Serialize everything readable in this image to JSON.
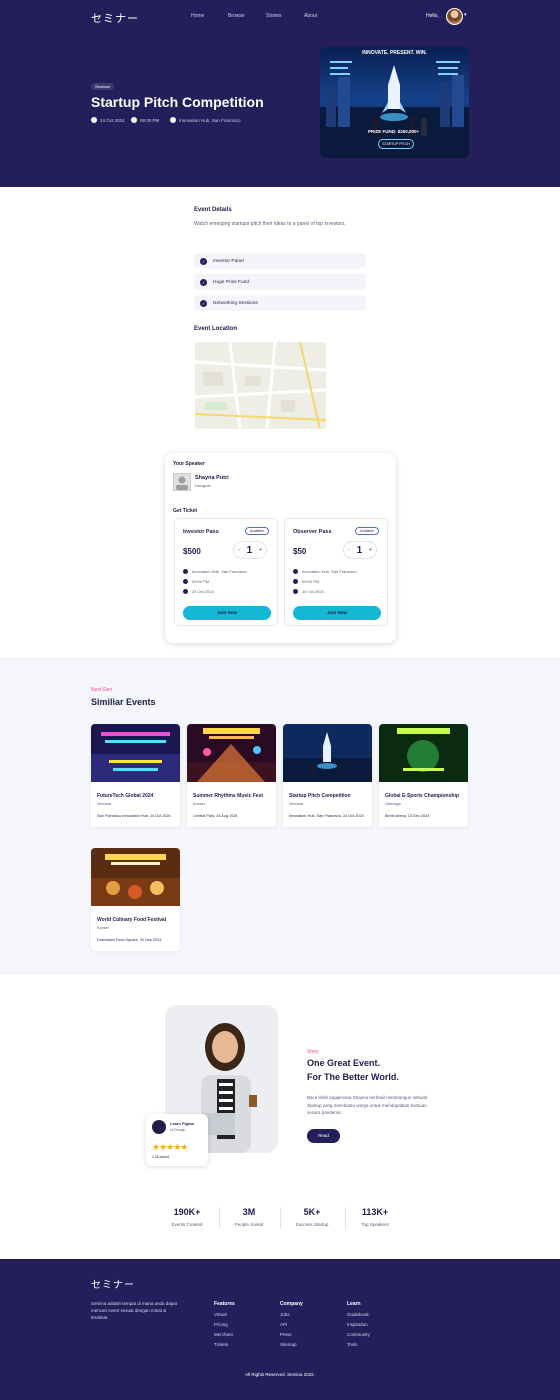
{
  "brand": {
    "logo": "セミナー"
  },
  "nav": {
    "items": [
      "Home",
      "Browse",
      "Stories",
      "About"
    ],
    "greeting": "Hello,"
  },
  "hero": {
    "tag": "Seminar",
    "title": "Startup Pitch Competition",
    "date": "24 Oct 2024",
    "time": "09:00 PM",
    "location": "Innovation Hub, San Francisco",
    "poster": {
      "headline": "INNOVATE. PRESENT. WIN.",
      "prize": "PRIZE FUND: $250,000+",
      "badge": "STARTUP PITCH"
    }
  },
  "details": {
    "heading": "Event Details",
    "description": "Watch emerging startups pitch their ideas to a panel of top investors.",
    "features": [
      "Investor Panel",
      "Huge Prize Fund",
      "Networking Sessions"
    ],
    "location_heading": "Event Location"
  },
  "speaker": {
    "heading": "Your Speaker",
    "name": "Shayna Putri",
    "role": "Designer"
  },
  "tickets": {
    "heading": "Get Ticket",
    "items": [
      {
        "name": "Investor Pass",
        "badge": "Available",
        "price": "$500",
        "qty": "1",
        "location": "Innovation Hub, San Francisco",
        "time": "09:00 PM",
        "date": "24 Oct 2024",
        "cta": "Join Now"
      },
      {
        "name": "Observer Pass",
        "badge": "Available",
        "price": "$50",
        "qty": "1",
        "location": "Innovation Hub, San Francisco",
        "time": "09:00 PM",
        "date": "24 Oct 2024",
        "cta": "Join Now"
      }
    ],
    "minus": "-",
    "plus": "+"
  },
  "similar": {
    "eyebrow": "Next Gen",
    "heading": "Similiar Events",
    "events": [
      {
        "title": "FutureTech Global 2024",
        "category": "Seminar",
        "location": "San Francisco Innovation Hub, 14 Oct 2024"
      },
      {
        "title": "Summer Rhythms Music Fest",
        "category": "Konser",
        "location": "Central Park, 24 Aug 2024"
      },
      {
        "title": "Startup Pitch Competition",
        "category": "Seminar",
        "location": "Innovation Hub, San Francisco, 24 Oct 2024"
      },
      {
        "title": "Global E-Sports Championship",
        "category": "Olahraga",
        "location": "Berlin Arena, 13 Dec 2024"
      },
      {
        "title": "World Culinary Food Festival",
        "category": "Konser",
        "location": "Downtown Food Square, 31 Sep 2024"
      }
    ]
  },
  "about": {
    "eyebrow": "Story",
    "title_line1": "One Great Event.",
    "title_line2": "For The Better World.",
    "body": "Baca lebih bagaimana Shayna berhasil membangun sebuah Startup yang membantu warga untuk mendapatkan bantuan secara pandemic.",
    "cta": "Read",
    "rating": {
      "name": "Learn Figma",
      "sub": "UI Design",
      "stars": "★★★★★",
      "count": "1.2k joined"
    }
  },
  "stats": [
    {
      "value": "190K+",
      "label": "Events Created"
    },
    {
      "value": "3M",
      "label": "People Joined"
    },
    {
      "value": "5K+",
      "label": "Success Startup"
    },
    {
      "value": "113K+",
      "label": "Top Speakers"
    }
  ],
  "footer": {
    "logo": "セミナー",
    "about": "Semina adalah tempat di mana anda dapat mencari event sesuai dengan minat & terdekat.",
    "columns": [
      {
        "heading": "Features",
        "links": [
          "Virtual",
          "Pricing",
          "Merchant",
          "Tickets"
        ]
      },
      {
        "heading": "Company",
        "links": [
          "Jobs",
          "API",
          "Press",
          "Sitemap"
        ]
      },
      {
        "heading": "Learn",
        "links": [
          "Guidebook",
          "Inspiration",
          "Community",
          "Tools"
        ]
      }
    ],
    "copyright": "All Rights Reserved. Semina 2022."
  },
  "colors": {
    "primary": "#241f5b",
    "accent": "#14b8d4",
    "pink": "#f0498a",
    "card_bg": "#ffffff"
  }
}
